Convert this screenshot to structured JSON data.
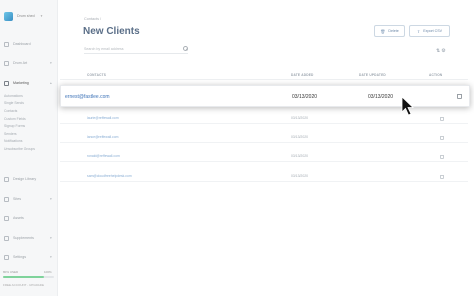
{
  "sidebar": {
    "brand": "Drum shed",
    "items": [
      {
        "label": "Dashboard",
        "icon": "dashboard-icon"
      },
      {
        "label": "Drum Art",
        "icon": "drum-icon"
      },
      {
        "label": "Marketing",
        "icon": "megaphone-icon"
      },
      {
        "label": "Design Library",
        "icon": "palette-icon"
      },
      {
        "label": "Sites",
        "icon": "sites-icon"
      },
      {
        "label": "Assets",
        "icon": "assets-icon"
      },
      {
        "label": "Supplements",
        "icon": "supplements-icon"
      },
      {
        "label": "Settings",
        "icon": "gear-icon"
      }
    ],
    "marketing_subitems": [
      "Automations",
      "Single Sends",
      "Contacts",
      "Custom Fields",
      "Signup Forms",
      "Senders",
      "Notifications",
      "Unsubscribe Groups"
    ],
    "usage_label": "80% USED",
    "usage_pct": "100%",
    "usage_fraction": 0.8,
    "plan_label": "FREE ACCOUNT - UPGRADE"
  },
  "header": {
    "breadcrumb": "Contacts  /",
    "title": "New Clients",
    "delete_label": "Delete",
    "export_label": "Export CSV"
  },
  "search": {
    "placeholder": "Search by email address"
  },
  "table": {
    "headers": {
      "contacts": "CONTACTS",
      "date_added": "DATE ADDED",
      "date_updated": "DATE UPDATED",
      "action": "ACTION"
    },
    "highlighted_row": {
      "email": "ernest@fastlee.com",
      "date_added": "03/13/2020",
      "date_updated": "03/13/2020"
    },
    "rows": [
      {
        "email": "laurie@reffewall.com",
        "date_added": "03/13/2020"
      },
      {
        "email": "lance@reffewall.com",
        "date_added": "03/13/2020"
      },
      {
        "email": "ronald@reffewall.com",
        "date_added": "03/13/2020"
      },
      {
        "email": "sam@cloudfreehelpdesk.com",
        "date_added": "03/13/2020"
      }
    ]
  },
  "colors": {
    "accent": "#3f74b8",
    "title": "#5b6f88",
    "usage": "#7fd39b"
  }
}
